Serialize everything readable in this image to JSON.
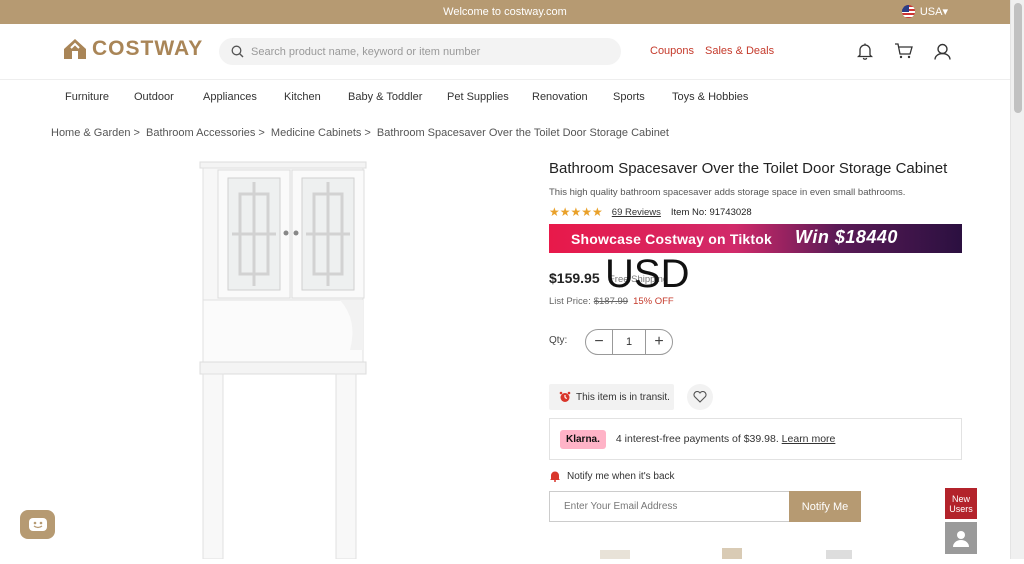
{
  "topbar": {
    "welcome": "Welcome to costway.com",
    "country": "USA▾"
  },
  "header": {
    "logo_text": "COSTWAY",
    "search_placeholder": "Search product name, keyword or item number",
    "coupons": "Coupons",
    "sales_deals": "Sales & Deals"
  },
  "nav": {
    "items": [
      "Furniture",
      "Outdoor",
      "Appliances",
      "Kitchen",
      "Baby & Toddler",
      "Pet Supplies",
      "Renovation",
      "Sports",
      "Toys & Hobbies"
    ]
  },
  "breadcrumb": {
    "items": [
      "Home & Garden",
      ">",
      "Bathroom Accessories",
      ">",
      "Medicine Cabinets",
      ">",
      "Bathroom Spacesaver Over the Toilet Door Storage Cabinet"
    ]
  },
  "product": {
    "title": "Bathroom Spacesaver Over the Toilet Door Storage Cabinet",
    "subtitle": "This high quality bathroom spacesaver adds storage space in even small bathrooms.",
    "stars": "★★★★★",
    "rating": 5,
    "reviews": "69 Reviews",
    "item_no": "Item No: 91743028",
    "price": "$159.95",
    "overlay_currency": "USD",
    "shipping": "Free Shipping",
    "list_price_label": "List Price:",
    "list_price": "$187.99",
    "discount": "15% OFF",
    "qty_label": "Qty:",
    "qty_value": "1",
    "qty_minus": "−",
    "qty_plus": "+",
    "transit": "This item is in transit.",
    "klarna_badge": "Klarna.",
    "klarna_text": "4 interest-free payments of $39.98.",
    "klarna_learn": "Learn more",
    "notify_label": "Notify me when it's back",
    "email_placeholder": "Enter Your Email Address",
    "notify_button": "Notify Me"
  },
  "banner": {
    "left": "Showcase Costway on Tiktok",
    "right": "Win $18440"
  },
  "widgets": {
    "new_users": "New Users"
  },
  "colors": {
    "brand": "#b69a72",
    "accent_red": "#c53a2b",
    "star": "#e9a12a"
  }
}
